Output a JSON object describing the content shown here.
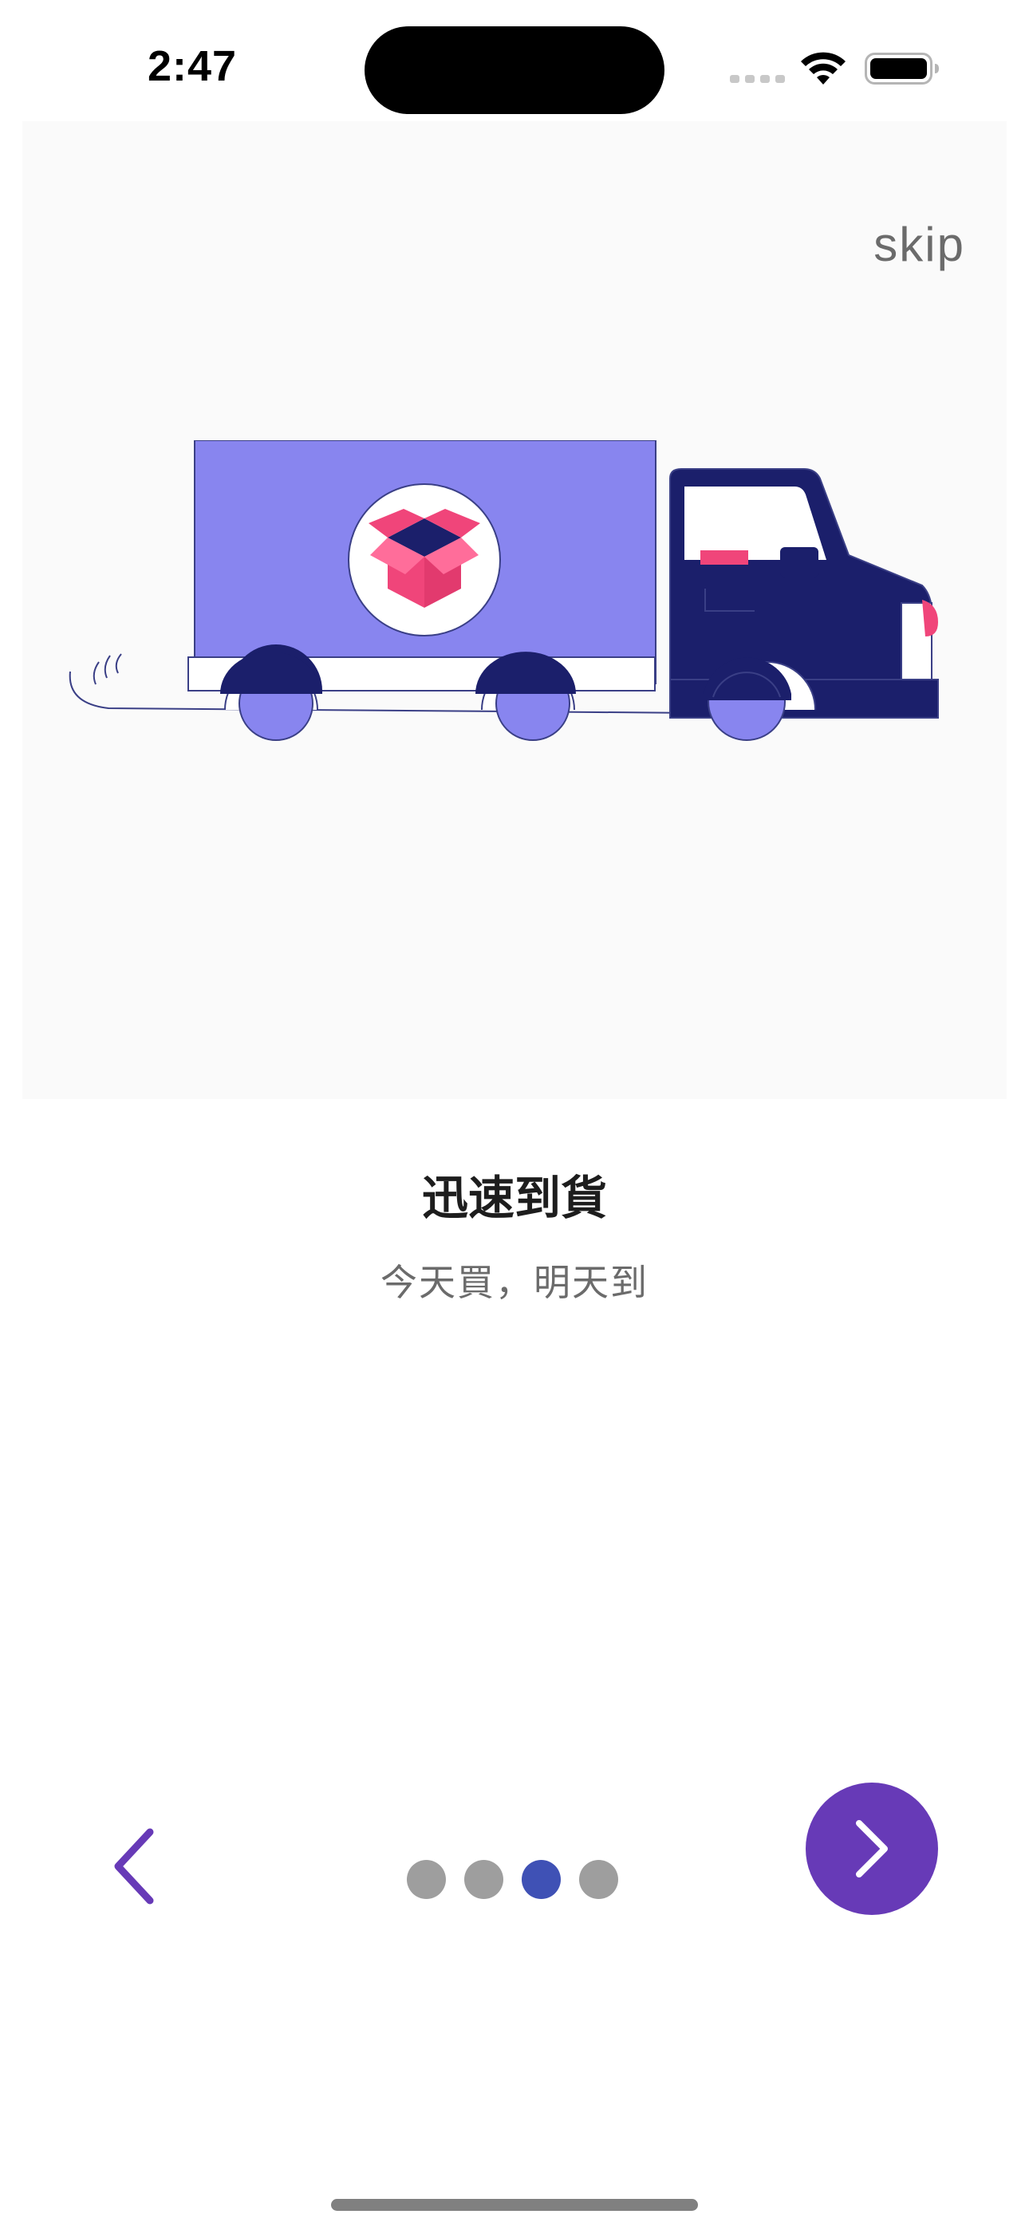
{
  "status_bar": {
    "time": "2:47",
    "icons": [
      "cellular-signal-icon",
      "wifi-icon",
      "battery-icon"
    ]
  },
  "onboarding": {
    "skip_label": "skip",
    "illustration": "delivery-truck-illustration",
    "title": "迅速到貨",
    "subtitle": "今天買，明天到",
    "pagination": {
      "total_pages": 4,
      "current_page": 3
    },
    "back_icon": "chevron-left-icon",
    "next_icon": "chevron-right-icon"
  },
  "colors": {
    "accent": "#673ab7",
    "active_dot": "#3f51b5",
    "inactive_dot": "#9e9e9e",
    "truck_box": "#8885ef",
    "truck_cab": "#1b1f6b",
    "package": "#f0457a"
  }
}
